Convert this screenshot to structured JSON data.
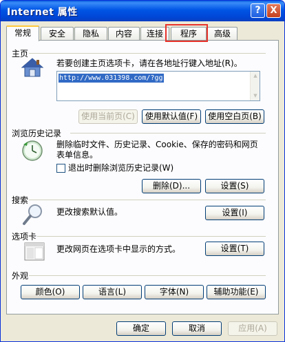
{
  "window": {
    "title": "Internet 属性",
    "help_glyph": "?",
    "close_glyph": "X"
  },
  "tabs": [
    {
      "label": "常规",
      "active": true
    },
    {
      "label": "安全"
    },
    {
      "label": "隐私"
    },
    {
      "label": "内容"
    },
    {
      "label": "连接"
    },
    {
      "label": "程序",
      "highlighted": true
    },
    {
      "label": "高级"
    }
  ],
  "homepage": {
    "section_label": "主页",
    "instruction": "若要创建主页选项卡，请在各地址行键入地址(R)。",
    "url": "http://www.031398.com/?gg",
    "use_current_label": "使用当前页(C)",
    "use_default_label": "使用默认值(F)",
    "use_blank_label": "使用空白页(B)"
  },
  "history": {
    "section_label": "浏览历史记录",
    "description_line1": "删除临时文件、历史记录、Cookie、保存的密码和网页",
    "description_line2": "表单信息。",
    "checkbox_label": "退出时删除浏览历史记录(W)",
    "delete_label": "删除(D)...",
    "settings_label": "设置(S)"
  },
  "search": {
    "section_label": "搜索",
    "description": "更改搜索默认值。",
    "settings_label": "设置(I)"
  },
  "tabs_section": {
    "section_label": "选项卡",
    "description": "更改网页在选项卡中显示的方式。",
    "settings_label": "设置(T)"
  },
  "appearance": {
    "section_label": "外观",
    "colors_label": "颜色(O)",
    "languages_label": "语言(L)",
    "fonts_label": "字体(N)",
    "accessibility_label": "辅助功能(E)"
  },
  "footer": {
    "ok_label": "确定",
    "cancel_label": "取消",
    "apply_label": "应用(A)"
  },
  "colors": {
    "titlebar": "#0055e5",
    "highlight": "#e8322a",
    "selection": "#316ac5"
  }
}
